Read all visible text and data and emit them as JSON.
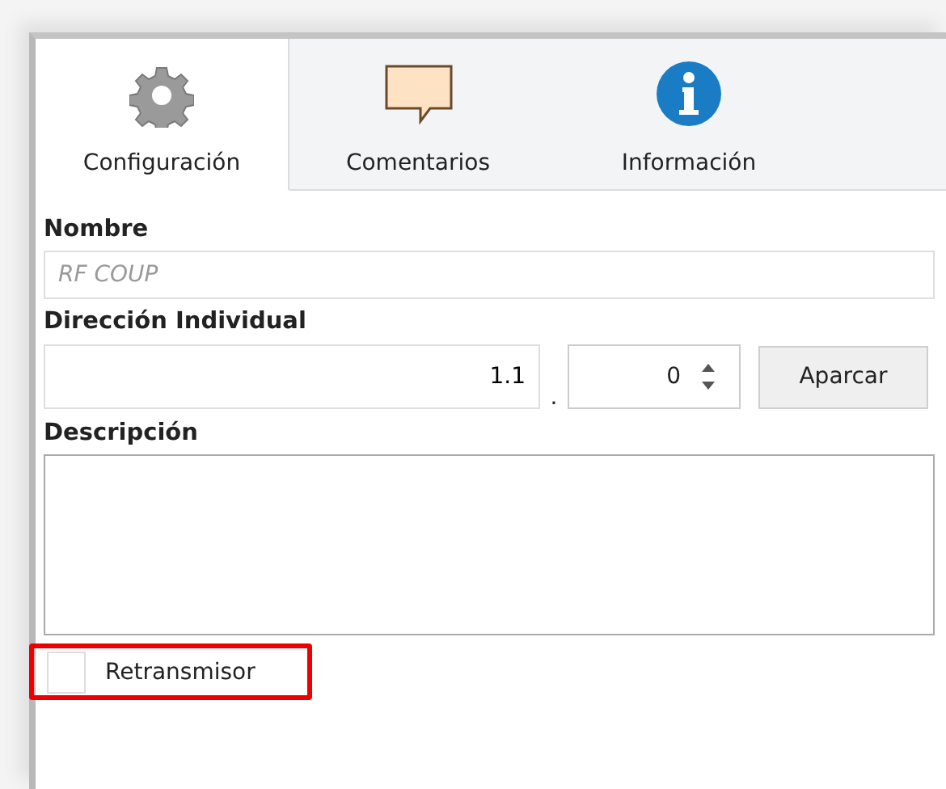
{
  "tabs": [
    {
      "label": "Configuración",
      "kind": "gear",
      "selected": true
    },
    {
      "label": "Comentarios",
      "kind": "comment",
      "selected": false
    },
    {
      "label": "Información",
      "kind": "info",
      "selected": false
    }
  ],
  "name": {
    "label": "Nombre",
    "placeholder": "RF COUP"
  },
  "address": {
    "label": "Dirección Individual",
    "value": "1.1",
    "separator": ".",
    "number": "0",
    "button": "Aparcar"
  },
  "description": {
    "label": "Descripción"
  },
  "relay": {
    "label": "Retransmisor",
    "checked": false,
    "highlighted": true
  }
}
